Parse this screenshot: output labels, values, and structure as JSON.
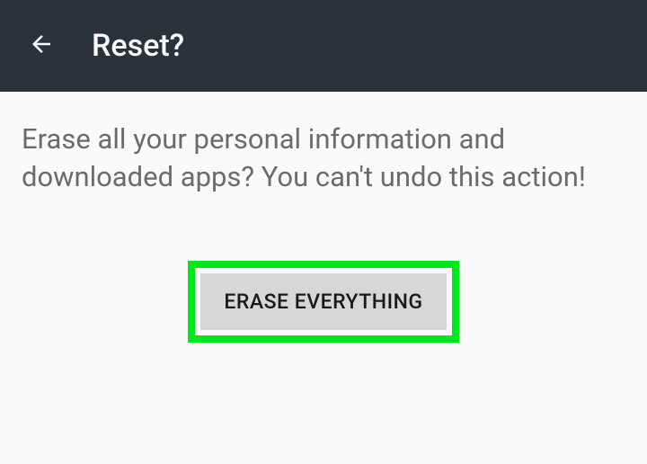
{
  "header": {
    "title": "Reset?"
  },
  "content": {
    "warning_text": "Erase all your personal information and downloaded apps? You can't undo this action!",
    "button_label": "ERASE EVERYTHING"
  }
}
